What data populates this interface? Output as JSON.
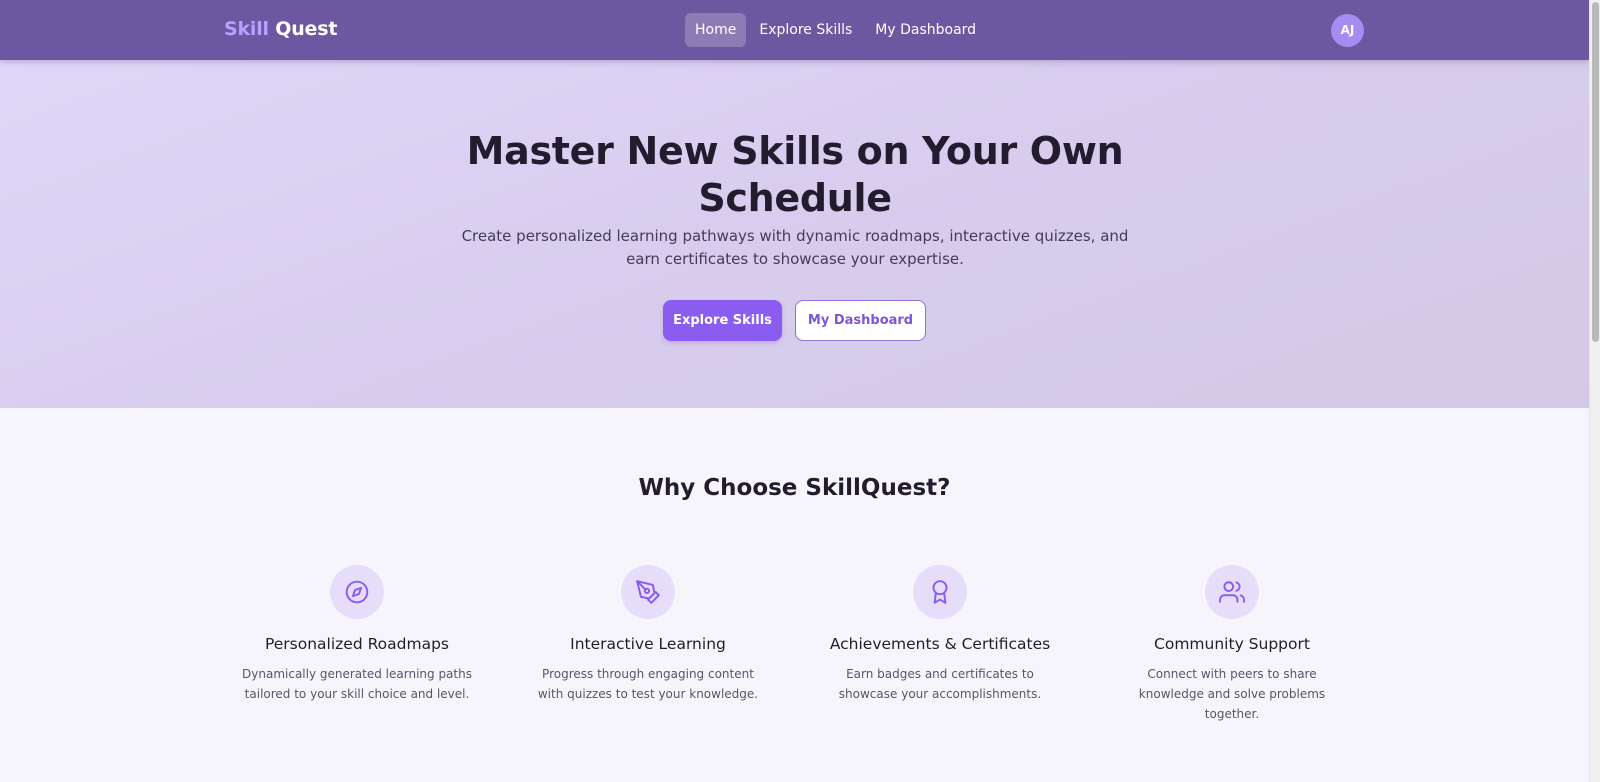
{
  "header": {
    "logo_part1": "Skill",
    "logo_part2": "Quest",
    "nav": [
      {
        "label": "Home",
        "active": true
      },
      {
        "label": "Explore Skills",
        "active": false
      },
      {
        "label": "My Dashboard",
        "active": false
      }
    ],
    "avatar_initials": "AJ"
  },
  "hero": {
    "title": "Master New Skills on Your Own Schedule",
    "subtitle": "Create personalized learning pathways with dynamic roadmaps, interactive quizzes, and earn certificates to showcase your expertise.",
    "primary_button": "Explore Skills",
    "secondary_button": "My Dashboard"
  },
  "features": {
    "title": "Why Choose SkillQuest?",
    "items": [
      {
        "icon": "compass-icon",
        "title": "Personalized Roadmaps",
        "description": "Dynamically generated learning paths tailored to your skill choice and level."
      },
      {
        "icon": "pen-tool-icon",
        "title": "Interactive Learning",
        "description": "Progress through engaging content with quizzes to test your knowledge."
      },
      {
        "icon": "award-icon",
        "title": "Achievements & Certificates",
        "description": "Earn badges and certificates to showcase your accomplishments."
      },
      {
        "icon": "users-icon",
        "title": "Community Support",
        "description": "Connect with peers to share knowledge and solve problems together."
      }
    ]
  },
  "colors": {
    "nav_bg": "#6c58a0",
    "accent": "#8a5cf0",
    "logo_accent": "#b7a0ff",
    "icon_bg": "#e6ddfa",
    "icon_stroke": "#8a5cf0"
  }
}
